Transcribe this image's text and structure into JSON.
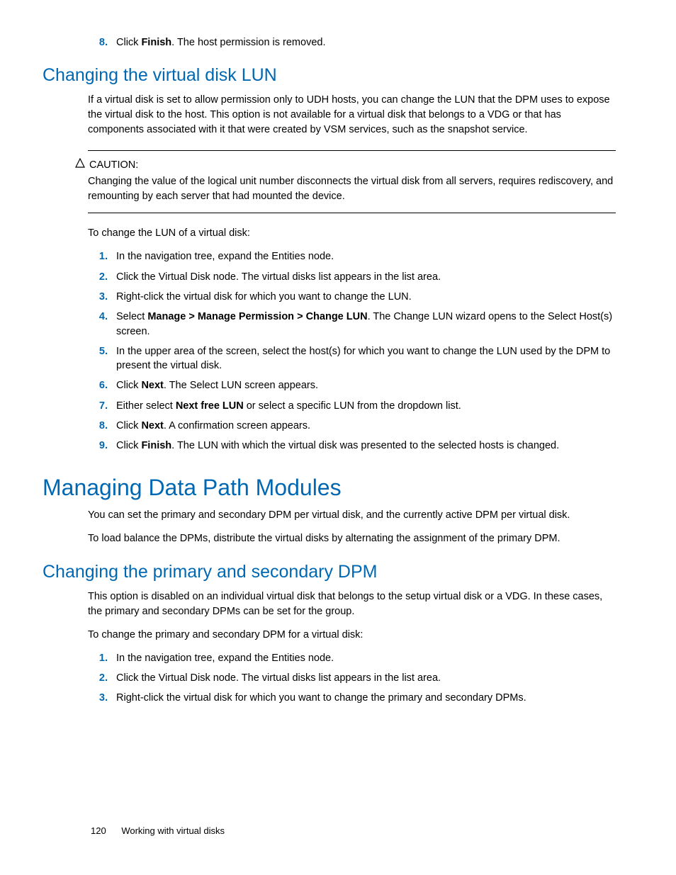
{
  "top_step": {
    "num": "8.",
    "pre": "Click ",
    "bold": "Finish",
    "post": ". The host permission is removed."
  },
  "sec1": {
    "heading": "Changing the virtual disk LUN",
    "intro": "If a virtual disk is set to allow permission only to UDH hosts, you can change the LUN that the DPM uses to expose the virtual disk to the host. This option is not available for a virtual disk that belongs to a VDG or that has components associated with it that were created by VSM services, such as the snapshot service.",
    "caution_label": "CAUTION:",
    "caution_body": "Changing the value of the logical unit number disconnects the virtual disk from all servers, requires rediscovery, and remounting by each server that had mounted the device.",
    "lead": "To change the LUN of a virtual disk:",
    "steps": {
      "s1": {
        "num": "1.",
        "text": "In the navigation tree, expand the Entities node."
      },
      "s2": {
        "num": "2.",
        "text": "Click the Virtual Disk node. The virtual disks list appears in the list area."
      },
      "s3": {
        "num": "3.",
        "text": "Right-click the virtual disk for which you want to change the LUN."
      },
      "s4": {
        "num": "4.",
        "pre": "Select ",
        "bold": "Manage > Manage Permission > Change LUN",
        "post": ". The Change LUN wizard opens to the Select Host(s) screen."
      },
      "s5": {
        "num": "5.",
        "text": "In the upper area of the screen, select the host(s) for which you want to change the LUN used by the DPM to present the virtual disk."
      },
      "s6": {
        "num": "6.",
        "pre": "Click ",
        "bold": "Next",
        "post": ". The Select LUN screen appears."
      },
      "s7": {
        "num": "7.",
        "pre": "Either select ",
        "bold": "Next free LUN",
        "post": " or select a specific LUN from the dropdown list."
      },
      "s8": {
        "num": "8.",
        "pre": "Click ",
        "bold": "Next",
        "post": ". A confirmation screen appears."
      },
      "s9": {
        "num": "9.",
        "pre": "Click ",
        "bold": "Finish",
        "post": ". The LUN with which the virtual disk was presented to the selected hosts is changed."
      }
    }
  },
  "sec2": {
    "heading": "Managing Data Path Modules",
    "p1": "You can set the primary and secondary DPM per virtual disk, and the currently active DPM per virtual disk.",
    "p2": "To load balance the DPMs, distribute the virtual disks by alternating the assignment of the primary DPM."
  },
  "sec3": {
    "heading": "Changing the primary and secondary DPM",
    "intro": "This option is disabled on an individual virtual disk that belongs to the setup virtual disk or a VDG. In these cases, the primary and secondary DPMs can be set for the group.",
    "lead": "To change the primary and secondary DPM for a virtual disk:",
    "steps": {
      "s1": {
        "num": "1.",
        "text": "In the navigation tree, expand the Entities node."
      },
      "s2": {
        "num": "2.",
        "text": "Click the Virtual Disk node. The virtual disks list appears in the list area."
      },
      "s3": {
        "num": "3.",
        "text": "Right-click the virtual disk for which you want to change the primary and secondary DPMs."
      }
    }
  },
  "footer": {
    "page": "120",
    "title": "Working with virtual disks"
  }
}
